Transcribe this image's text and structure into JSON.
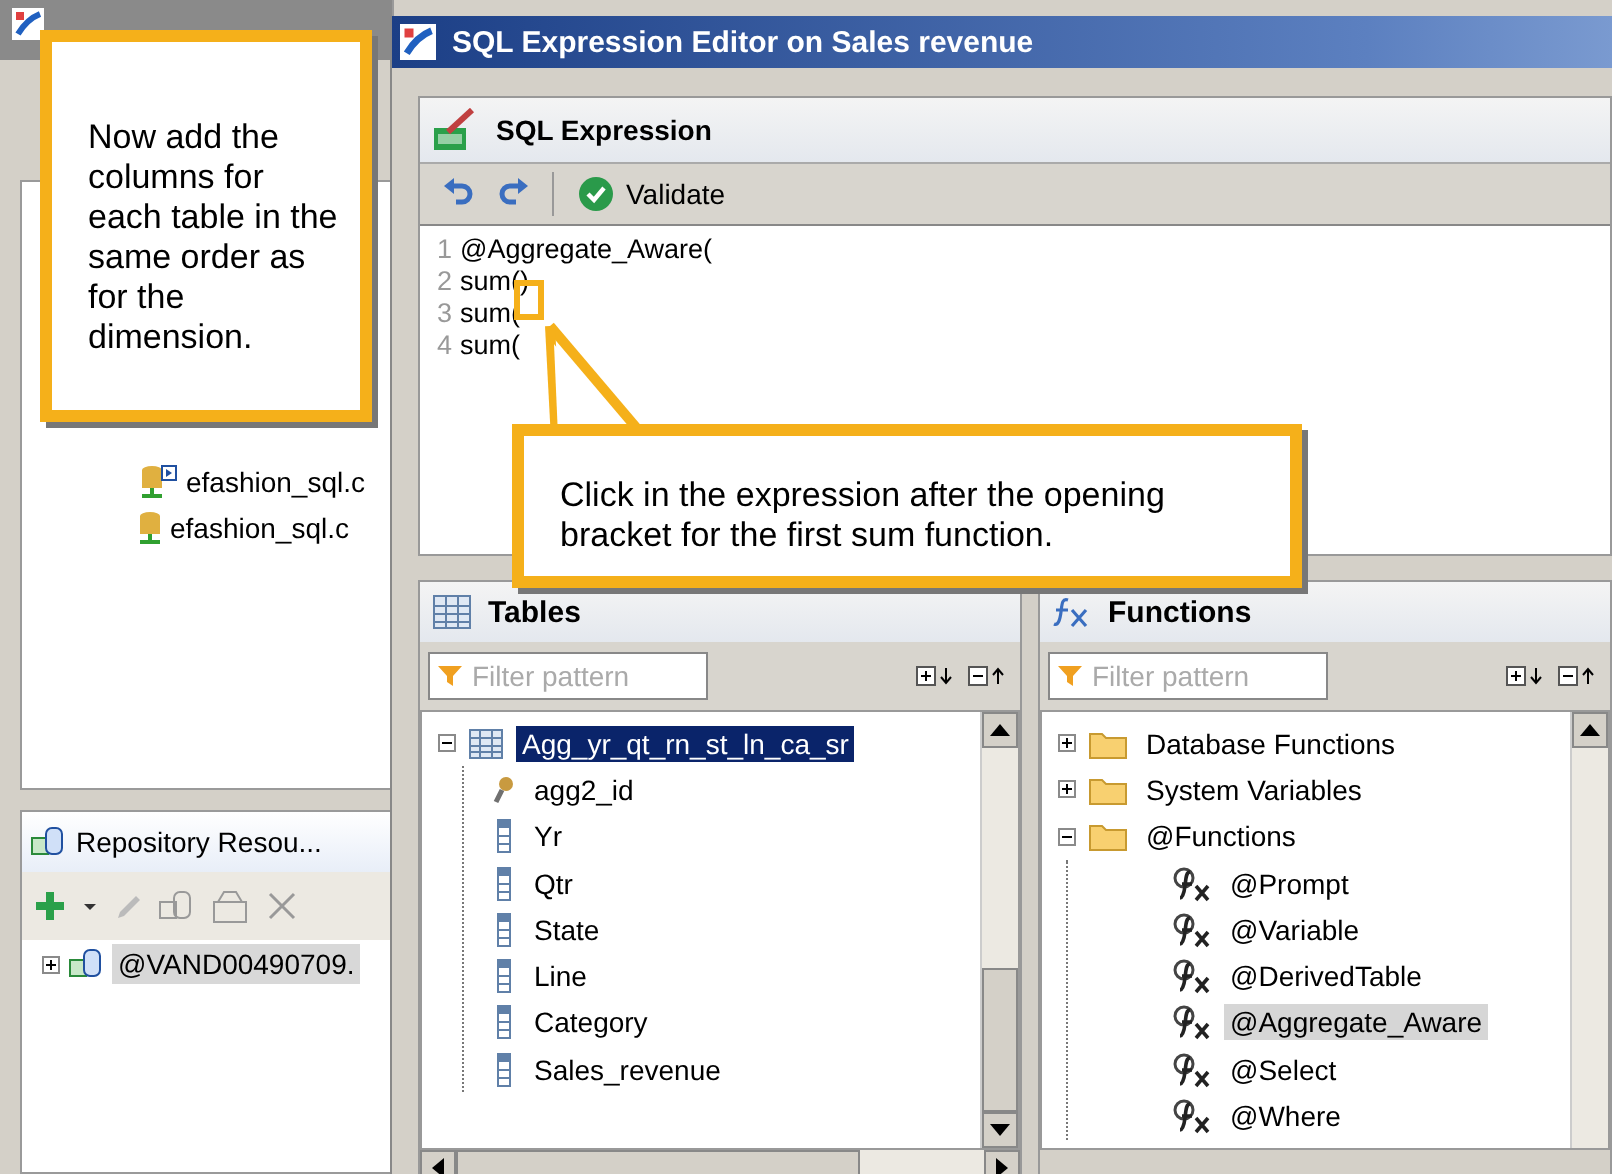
{
  "left_window": {
    "tree_items": [
      {
        "label": "efashion_sql.c",
        "kind": "linked"
      },
      {
        "label": "efashion_sql.c",
        "kind": "plain"
      }
    ],
    "repository": {
      "title": "Repository Resou...",
      "items": [
        {
          "label": "@VAND00490709.",
          "expanded": false,
          "selected": true
        }
      ]
    }
  },
  "dialog": {
    "title": "SQL Expression Editor on Sales revenue",
    "section": "SQL Expression",
    "validate": "Validate",
    "editor": {
      "lines": [
        {
          "number": "1",
          "text": "@Aggregate_Aware("
        },
        {
          "number": "2",
          "text": "sum()"
        },
        {
          "number": "3",
          "text": "sum("
        },
        {
          "number": "4",
          "text": "sum("
        }
      ]
    }
  },
  "tables": {
    "title": "Tables",
    "filter": {
      "placeholder": "Filter pattern"
    },
    "tree": [
      {
        "label": "Agg_yr_qt_rn_st_ln_ca_sr",
        "expanded": true,
        "selected": true,
        "children": [
          {
            "label": "agg2_id",
            "kind": "key",
            "selected": false
          },
          {
            "label": "Yr",
            "kind": "column",
            "selected": false
          },
          {
            "label": "Qtr",
            "kind": "column",
            "selected": false
          },
          {
            "label": "State",
            "kind": "column",
            "selected": false
          },
          {
            "label": "Line",
            "kind": "column",
            "selected": false
          },
          {
            "label": "Category",
            "kind": "column",
            "selected": false
          },
          {
            "label": "Sales_revenue",
            "kind": "column",
            "selected": false
          }
        ]
      }
    ]
  },
  "functions": {
    "title": "Functions",
    "filter": {
      "placeholder": "Filter pattern"
    },
    "tree": [
      {
        "label": "Database Functions",
        "expanded": false,
        "selected": false
      },
      {
        "label": "System Variables",
        "expanded": false,
        "selected": false
      },
      {
        "label": "@Functions",
        "expanded": true,
        "selected": false,
        "children": [
          {
            "label": "@Prompt",
            "selected": false
          },
          {
            "label": "@Variable",
            "selected": false
          },
          {
            "label": "@DerivedTable",
            "selected": false
          },
          {
            "label": "@Aggregate_Aware",
            "selected": true
          },
          {
            "label": "@Select",
            "selected": false
          },
          {
            "label": "@Where",
            "selected": false
          }
        ]
      }
    ]
  },
  "callouts": [
    {
      "text": "Now add the columns for each table in the same order as for the dimension."
    },
    {
      "text": "Click in the expression after the opening bracket for the first sum function."
    }
  ]
}
